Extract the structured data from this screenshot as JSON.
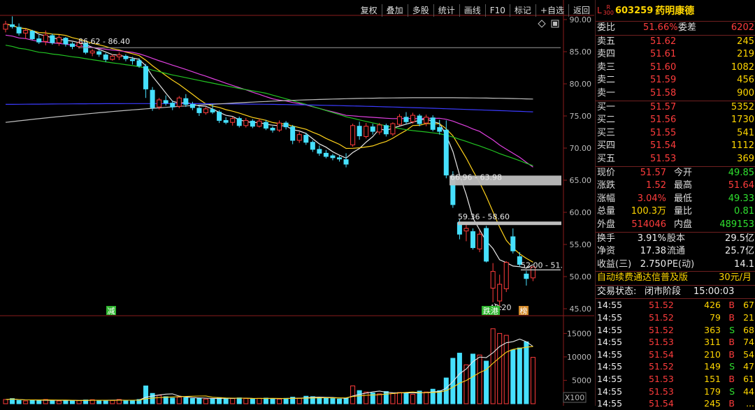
{
  "toolbar": [
    "复权",
    "叠加",
    "多股",
    "统计",
    "画线",
    "F10",
    "标记",
    "+自选",
    "返回"
  ],
  "header": {
    "market_letter": "L",
    "tag_r": "R",
    "tag_num": "300",
    "code": "603259",
    "name": "药明康德"
  },
  "commission": {
    "ratio_label": "委比",
    "ratio_value": "51.66%",
    "diff_label": "委差",
    "diff_value": "6202"
  },
  "asks": [
    {
      "label": "卖五",
      "price": "51.62",
      "vol": "245"
    },
    {
      "label": "卖四",
      "price": "51.61",
      "vol": "219"
    },
    {
      "label": "卖三",
      "price": "51.60",
      "vol": "1082"
    },
    {
      "label": "卖二",
      "price": "51.59",
      "vol": "456"
    },
    {
      "label": "卖一",
      "price": "51.58",
      "vol": "900"
    }
  ],
  "bids": [
    {
      "label": "买一",
      "price": "51.57",
      "vol": "5352"
    },
    {
      "label": "买二",
      "price": "51.56",
      "vol": "1730"
    },
    {
      "label": "买三",
      "price": "51.55",
      "vol": "541"
    },
    {
      "label": "买四",
      "price": "51.54",
      "vol": "1112"
    },
    {
      "label": "买五",
      "price": "51.53",
      "vol": "369"
    }
  ],
  "quote": [
    {
      "l1": "现价",
      "v1": "51.57",
      "c1": "red",
      "l2": "今开",
      "v2": "49.85",
      "c2": "grn"
    },
    {
      "l1": "涨跌",
      "v1": "1.52",
      "c1": "red",
      "l2": "最高",
      "v2": "51.64",
      "c2": "red"
    },
    {
      "l1": "涨幅",
      "v1": "3.04%",
      "c1": "red",
      "l2": "最低",
      "v2": "49.33",
      "c2": "grn"
    },
    {
      "l1": "总量",
      "v1": "100.3万",
      "c1": "yel",
      "l2": "量比",
      "v2": "0.81",
      "c2": "grn"
    },
    {
      "l1": "外盘",
      "v1": "514046",
      "c1": "red",
      "l2": "内盘",
      "v2": "489153",
      "c2": "grn"
    }
  ],
  "finance": [
    {
      "l1": "换手",
      "v1": "3.91%",
      "l2": "股本",
      "v2": "29.5亿"
    },
    {
      "l1": "净资",
      "v1": "17.38",
      "l2": "流通",
      "v2": "25.7亿"
    },
    {
      "l1": "收益(三)",
      "v1": "2.750",
      "l2": "PE(动)",
      "v2": "14.1"
    }
  ],
  "ad": {
    "text": "自动续费通达信普及版",
    "price": "30元/月"
  },
  "status": {
    "label": "交易状态:",
    "value": "闭市阶段",
    "time": "15:00:03"
  },
  "ticks": [
    {
      "time": "14:55",
      "price": "51.52",
      "vol": "426",
      "bs": "B",
      "n": "67"
    },
    {
      "time": "14:55",
      "price": "51.52",
      "vol": "79",
      "bs": "B",
      "n": "21"
    },
    {
      "time": "14:55",
      "price": "51.52",
      "vol": "363",
      "bs": "S",
      "n": "68"
    },
    {
      "time": "14:55",
      "price": "51.53",
      "vol": "311",
      "bs": "B",
      "n": "74"
    },
    {
      "time": "14:55",
      "price": "51.54",
      "vol": "210",
      "bs": "B",
      "n": "54"
    },
    {
      "time": "14:55",
      "price": "51.52",
      "vol": "149",
      "bs": "S",
      "n": "47"
    },
    {
      "time": "14:55",
      "price": "51.53",
      "vol": "151",
      "bs": "B",
      "n": "61"
    },
    {
      "time": "14:55",
      "price": "51.53",
      "vol": "179",
      "bs": "S",
      "n": "44"
    },
    {
      "time": "14:55",
      "price": "51.54",
      "vol": "245",
      "bs": "B",
      "n": "..."
    }
  ],
  "chart_data": {
    "type": "candlestick",
    "price_axis": {
      "min": 45,
      "max": 90,
      "ticks": [
        "90.00",
        "85.00",
        "80.00",
        "75.00",
        "70.00",
        "65.00",
        "60.00",
        "55.00",
        "50.00",
        "45.00"
      ]
    },
    "volume_axis": {
      "ticks": [
        "15000",
        "10000",
        "5000"
      ],
      "unit": "X100"
    },
    "annotations": [
      {
        "text": "86.62 - 86.40",
        "price": 86.5
      },
      {
        "text": "66.96 - 63.98",
        "price": 65.5
      },
      {
        "text": "59.36 - 58.60",
        "price": 59.0
      },
      {
        "text": "52.00 - 51.",
        "price": 51.7
      },
      {
        "text": "45.20",
        "price": 45.2
      }
    ],
    "markers": [
      {
        "text": "减"
      },
      {
        "text": "跌港"
      },
      {
        "text": "榜"
      }
    ],
    "candles": [
      [
        88.5,
        89.8,
        88.0,
        89.3
      ],
      [
        89.2,
        90.5,
        88.6,
        88.9
      ],
      [
        88.8,
        89.4,
        87.5,
        87.9
      ],
      [
        87.9,
        88.6,
        87.0,
        88.3
      ],
      [
        88.2,
        88.4,
        86.8,
        87.0
      ],
      [
        87.0,
        87.6,
        86.2,
        86.5
      ],
      [
        86.6,
        88.3,
        86.0,
        87.6
      ],
      [
        87.5,
        87.8,
        86.1,
        86.4
      ],
      [
        86.4,
        87.6,
        85.9,
        87.2
      ],
      [
        87.1,
        87.3,
        85.8,
        86.2
      ],
      [
        86.2,
        86.5,
        85.4,
        85.8
      ],
      [
        85.8,
        86.7,
        85.5,
        86.4
      ],
      [
        86.3,
        86.5,
        84.6,
        84.9
      ],
      [
        84.8,
        85.4,
        84.3,
        85.1
      ],
      [
        85.0,
        85.3,
        84.2,
        84.6
      ],
      [
        84.5,
        84.8,
        83.4,
        83.8
      ],
      [
        83.8,
        84.6,
        83.6,
        84.3
      ],
      [
        84.2,
        84.9,
        83.7,
        84.5
      ],
      [
        84.3,
        84.6,
        83.5,
        83.9
      ],
      [
        83.8,
        84.2,
        83.0,
        83.6
      ],
      [
        83.6,
        84.0,
        82.5,
        82.8
      ],
      [
        82.7,
        83.1,
        77.8,
        79.2
      ],
      [
        79.0,
        79.5,
        75.8,
        76.3
      ],
      [
        76.4,
        77.8,
        76.0,
        77.5
      ],
      [
        77.4,
        78.2,
        76.6,
        77.0
      ],
      [
        77.0,
        77.4,
        75.9,
        76.4
      ],
      [
        76.5,
        78.1,
        76.2,
        77.8
      ],
      [
        77.7,
        78.4,
        76.4,
        76.8
      ],
      [
        76.8,
        77.2,
        75.9,
        76.3
      ],
      [
        76.2,
        76.7,
        75.0,
        75.5
      ],
      [
        75.5,
        76.4,
        75.2,
        76.1
      ],
      [
        76.0,
        76.8,
        75.3,
        75.6
      ],
      [
        75.6,
        75.9,
        73.9,
        74.3
      ],
      [
        74.3,
        74.8,
        73.7,
        74.0
      ],
      [
        74.0,
        74.9,
        73.5,
        74.6
      ],
      [
        74.6,
        74.9,
        73.2,
        73.5
      ],
      [
        73.5,
        74.7,
        73.2,
        74.3
      ],
      [
        74.2,
        74.5,
        73.1,
        73.4
      ],
      [
        73.4,
        74.6,
        73.2,
        74.2
      ],
      [
        74.0,
        74.4,
        72.8,
        73.1
      ],
      [
        73.1,
        73.4,
        72.4,
        72.8
      ],
      [
        72.8,
        74.3,
        72.5,
        73.9
      ],
      [
        73.9,
        74.2,
        72.9,
        73.3
      ],
      [
        73.3,
        73.6,
        70.6,
        71.2
      ],
      [
        71.2,
        72.5,
        70.8,
        72.1
      ],
      [
        72.0,
        72.4,
        70.5,
        70.9
      ],
      [
        70.9,
        71.2,
        69.4,
        69.8
      ],
      [
        69.8,
        70.4,
        68.8,
        69.2
      ],
      [
        69.2,
        69.7,
        68.4,
        68.7
      ],
      [
        68.8,
        69.1,
        68.1,
        68.5
      ],
      [
        68.5,
        68.8,
        67.9,
        68.3
      ],
      [
        68.2,
        69.2,
        67.0,
        67.5
      ],
      [
        70.5,
        73.8,
        70.2,
        73.5
      ],
      [
        73.4,
        74.1,
        71.3,
        71.9
      ],
      [
        71.8,
        73.9,
        71.5,
        73.4
      ],
      [
        73.3,
        73.8,
        72.1,
        72.6
      ],
      [
        72.5,
        73.9,
        72.1,
        73.6
      ],
      [
        73.5,
        73.8,
        71.8,
        72.2
      ],
      [
        72.2,
        74.0,
        71.9,
        73.8
      ],
      [
        73.7,
        75.3,
        73.5,
        74.9
      ],
      [
        74.8,
        75.6,
        73.7,
        74.1
      ],
      [
        74.1,
        75.5,
        73.8,
        75.1
      ],
      [
        75.0,
        75.3,
        73.4,
        73.8
      ],
      [
        73.9,
        75.2,
        73.4,
        74.8
      ],
      [
        74.7,
        75.1,
        72.6,
        72.9
      ],
      [
        73.2,
        74.4,
        72.1,
        72.6
      ],
      [
        72.8,
        74.3,
        65.3,
        65.8
      ],
      [
        65.6,
        66.4,
        60.7,
        61.2
      ],
      [
        58.4,
        58.9,
        55.8,
        56.6
      ],
      [
        57.1,
        58.2,
        55.5,
        57.5
      ],
      [
        57.0,
        57.5,
        54.2,
        54.5
      ],
      [
        54.3,
        57.2,
        53.8,
        56.6
      ],
      [
        57.5,
        57.9,
        52.2,
        52.4
      ],
      [
        48.2,
        52.1,
        46.0,
        50.8
      ],
      [
        46.2,
        50.3,
        45.2,
        48.8
      ],
      [
        48.1,
        52.4,
        47.6,
        52.2
      ],
      [
        56.2,
        57.5,
        53.6,
        54.0
      ],
      [
        53.1,
        53.8,
        51.6,
        51.9
      ],
      [
        50.4,
        50.9,
        48.6,
        49.7
      ],
      [
        49.8,
        51.6,
        49.3,
        51.5
      ]
    ],
    "ma_lines": [
      {
        "name": "MA5",
        "color": "#e6e6e6"
      },
      {
        "name": "MA10",
        "color": "#ffd21a"
      },
      {
        "name": "MA20",
        "color": "#e040e0"
      },
      {
        "name": "MA60",
        "color": "#22c322"
      },
      {
        "name": "MA120",
        "color": "#3b3bff"
      },
      {
        "name": "MA250",
        "color": "#bfbfbf"
      }
    ],
    "volume": [
      900,
      1100,
      700,
      600,
      800,
      650,
      900,
      700,
      600,
      750,
      700,
      650,
      800,
      850,
      700,
      750,
      700,
      900,
      650,
      700,
      900,
      3800,
      2200,
      1800,
      1500,
      1200,
      1400,
      1300,
      1100,
      1200,
      1000,
      1100,
      1300,
      1200,
      1100,
      1250,
      1100,
      1000,
      1150,
      1200,
      1100,
      1000,
      1150,
      1400,
      1200,
      1600,
      1500,
      1300,
      1200,
      1100,
      1000,
      1200,
      3800,
      2800,
      2500,
      2300,
      2100,
      2600,
      2200,
      2400,
      2300,
      2000,
      2700,
      2500,
      3100,
      2800,
      5500,
      9700,
      10800,
      8300,
      10600,
      10400,
      9100,
      16000,
      15000,
      14600,
      11500,
      11900,
      13200,
      9900
    ]
  }
}
